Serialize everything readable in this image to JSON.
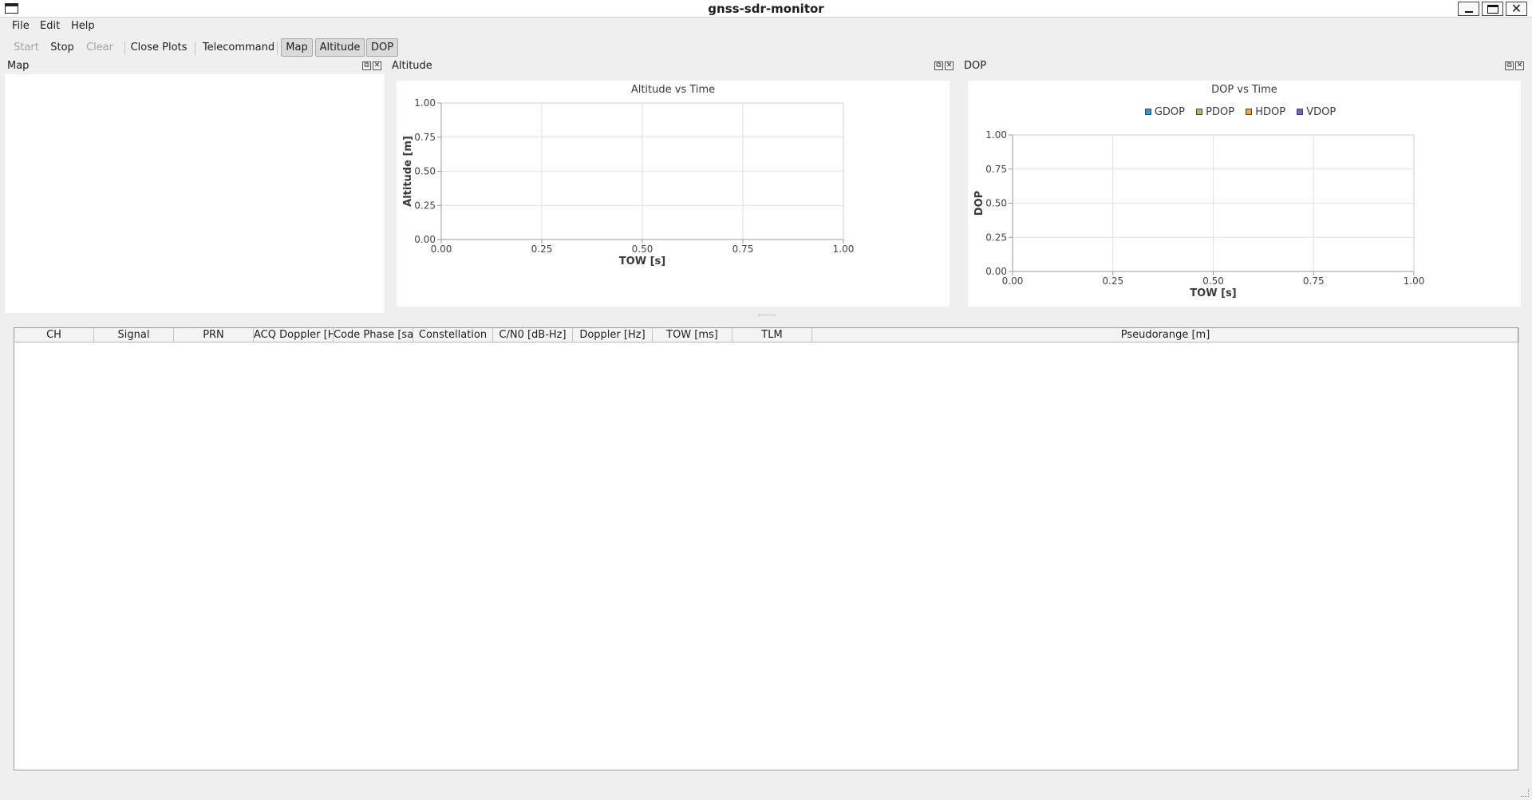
{
  "window": {
    "title": "gnss-sdr-monitor"
  },
  "menu": {
    "items": [
      "File",
      "Edit",
      "Help"
    ]
  },
  "toolbar": {
    "start": "Start",
    "stop": "Stop",
    "clear": "Clear",
    "close_plots": "Close Plots",
    "telecommand": "Telecommand",
    "map": "Map",
    "altitude": "Altitude",
    "dop": "DOP"
  },
  "docks": {
    "map": {
      "title": "Map"
    },
    "altitude": {
      "title": "Altitude"
    },
    "dop": {
      "title": "DOP"
    }
  },
  "chart_data": [
    {
      "type": "line",
      "title": "Altitude vs Time",
      "xlabel": "TOW [s]",
      "ylabel": "Altitude [m]",
      "xlim": [
        0,
        1
      ],
      "ylim": [
        0,
        1
      ],
      "xticks": [
        "0.00",
        "0.25",
        "0.50",
        "0.75",
        "1.00"
      ],
      "yticks": [
        "0.00",
        "0.25",
        "0.50",
        "0.75",
        "1.00"
      ],
      "grid": true,
      "series": []
    },
    {
      "type": "line",
      "title": "DOP vs Time",
      "xlabel": "TOW [s]",
      "ylabel": "DOP",
      "xlim": [
        0,
        1
      ],
      "ylim": [
        0,
        1
      ],
      "xticks": [
        "0.00",
        "0.25",
        "0.50",
        "0.75",
        "1.00"
      ],
      "yticks": [
        "0.00",
        "0.25",
        "0.50",
        "0.75",
        "1.00"
      ],
      "grid": true,
      "legend": "top-center",
      "series": [
        {
          "name": "GDOP",
          "color": "#209fdf",
          "values": []
        },
        {
          "name": "PDOP",
          "color": "#99ca53",
          "values": []
        },
        {
          "name": "HDOP",
          "color": "#f6a625",
          "values": []
        },
        {
          "name": "VDOP",
          "color": "#6d5fd5",
          "values": []
        }
      ]
    }
  ],
  "table": {
    "columns": [
      "CH",
      "Signal",
      "PRN",
      "ACQ Doppler [Hz]",
      "Code Phase [samples]",
      "Constellation",
      "C/N0 [dB-Hz]",
      "Doppler [Hz]",
      "TOW [ms]",
      "TLM",
      "Pseudorange [m]"
    ],
    "rows": []
  }
}
